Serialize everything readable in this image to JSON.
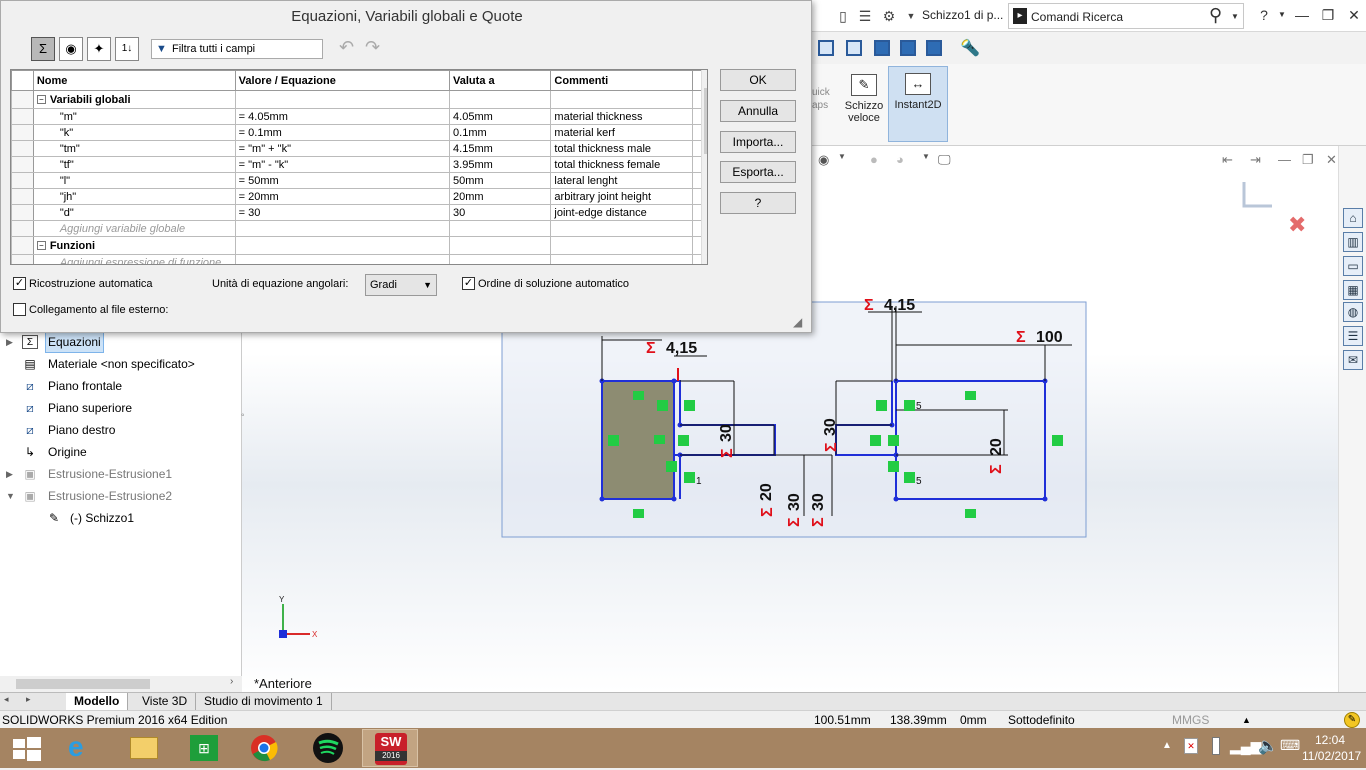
{
  "sw_window": {
    "doc_title": "Schizzo1 di p...",
    "search_label": "Comandi Ricerca",
    "help_label": "?",
    "minimize_label": "—",
    "restore_label": "❐",
    "close_label": "✕"
  },
  "commands": {
    "quick_snaps": [
      "uick",
      "aps"
    ],
    "schizzo_veloce": [
      "Schizzo",
      "veloce"
    ],
    "instant2d": "Instant2D"
  },
  "dialog": {
    "title": "Equazioni, Variabili globali e Quote",
    "filter_placeholder": "Filtra tutti i campi",
    "columns": [
      "Nome",
      "Valore / Equazione",
      "Valuta a",
      "Commenti"
    ],
    "groups": {
      "global_vars": "Variabili globali",
      "functions": "Funzioni"
    },
    "rows": [
      {
        "name": "\"m\"",
        "value": "= 4.05mm",
        "evaluates": "4.05mm",
        "comment": "material thickness"
      },
      {
        "name": "\"k\"",
        "value": "= 0.1mm",
        "evaluates": "0.1mm",
        "comment": "material kerf"
      },
      {
        "name": "\"tm\"",
        "value": "= \"m\" + \"k\"",
        "evaluates": "4.15mm",
        "comment": "total thickness male"
      },
      {
        "name": "\"tf\"",
        "value": "= \"m\" - \"k\"",
        "evaluates": "3.95mm",
        "comment": "total thickness female"
      },
      {
        "name": "\"l\"",
        "value": "= 50mm",
        "evaluates": "50mm",
        "comment": "lateral lenght"
      },
      {
        "name": "\"jh\"",
        "value": "= 20mm",
        "evaluates": "20mm",
        "comment": "arbitrary joint height"
      },
      {
        "name": "\"d\"",
        "value": "= 30",
        "evaluates": "30",
        "comment": "joint-edge distance"
      }
    ],
    "add_global_placeholder": "Aggiungi variabile globale",
    "add_function_placeholder": "Aggiungi espressione di funzione",
    "buttons": {
      "ok": "OK",
      "cancel": "Annulla",
      "import": "Importa...",
      "export": "Esporta...",
      "help": "?"
    },
    "auto_rebuild_label": "Ricostruzione automatica",
    "auto_rebuild_checked": true,
    "angle_units_label": "Unità di equazione angolari:",
    "angle_units_value": "Gradi",
    "auto_solve_label": "Ordine di soluzione automatico",
    "auto_solve_checked": true,
    "link_external_label": "Collegamento al file esterno:",
    "link_external_checked": false
  },
  "feature_tree": [
    {
      "label": "Equazioni",
      "icon": "sigma-icon",
      "selected": true,
      "expander": "▶"
    },
    {
      "label": "Materiale <non specificato>",
      "icon": "material-icon"
    },
    {
      "label": "Piano frontale",
      "icon": "plane-icon"
    },
    {
      "label": "Piano superiore",
      "icon": "plane-icon"
    },
    {
      "label": "Piano destro",
      "icon": "plane-icon"
    },
    {
      "label": "Origine",
      "icon": "origin-icon"
    },
    {
      "label": "Estrusione-Estrusione1",
      "icon": "extrude-icon",
      "greyed": true,
      "expander": "▶"
    },
    {
      "label": "Estrusione-Estrusione2",
      "icon": "extrude-icon",
      "greyed": true,
      "expander": "▼"
    },
    {
      "label": "(-) Schizzo1",
      "icon": "sketch-icon"
    }
  ],
  "viewport": {
    "view_label": "*Anteriore",
    "triad_y": "Y",
    "triad_x": "X",
    "dims": {
      "d415_left": "4,15",
      "d415_top": "4,15",
      "d100": "100",
      "d30": "30",
      "d20": "20"
    },
    "relation_index": {
      "one": "1",
      "five": "5"
    },
    "sigma": "Σ"
  },
  "bottom_tabs": [
    "Modello",
    "Viste 3D",
    "Studio di movimento 1"
  ],
  "status": {
    "app": "SOLIDWORKS Premium 2016 x64 Edition",
    "x": "100.51mm",
    "y": "138.39mm",
    "z": "0mm",
    "state": "Sottodefinito",
    "units": "MMGS"
  },
  "taskbar": {
    "time": "12:04",
    "date": "11/02/2017",
    "sw_badge": "2016"
  },
  "colors": {
    "sketch_blue": "#1f2fd8",
    "dim_red": "#e0101a",
    "relation_green": "#22cc44",
    "taskbar": "#a58462",
    "selection": "#cce2f7"
  }
}
